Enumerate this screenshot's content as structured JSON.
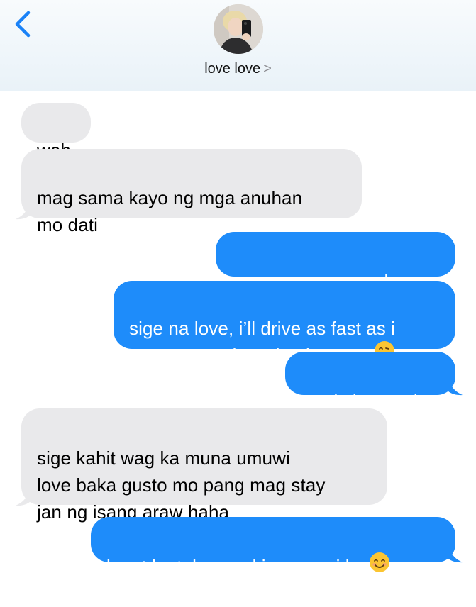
{
  "contact": {
    "name": "love love",
    "chevron": ">"
  },
  "icons": {
    "back": "chevron-left-icon",
    "kiss_emoji": "face-blowing-kiss-emoji-icon",
    "smile_emoji": "smiling-face-emoji-icon"
  },
  "colors": {
    "accent": "#1e8cfa",
    "incoming_bubble": "#e9e9eb",
    "back_chevron": "#1a82f7"
  },
  "messages": [
    {
      "direction": "incoming",
      "text": "weh"
    },
    {
      "direction": "incoming",
      "text": "mag sama kayo ng mga anuhan\nmo dati"
    },
    {
      "direction": "outgoing",
      "text": "yan nanaman po shea"
    },
    {
      "direction": "outgoing",
      "text": "sige na love, i’ll drive as fast as i\ncan para makauwi nako sayo"
    },
    {
      "direction": "outgoing",
      "text": "ready ka na ah"
    },
    {
      "direction": "incoming",
      "text": "sige kahit wag ka muna umuwi\nlove baka gusto mo pang mag stay\njan ng isang araw haha"
    },
    {
      "direction": "outgoing",
      "text": "lagot ka talaga sakin paguwi ko"
    }
  ]
}
